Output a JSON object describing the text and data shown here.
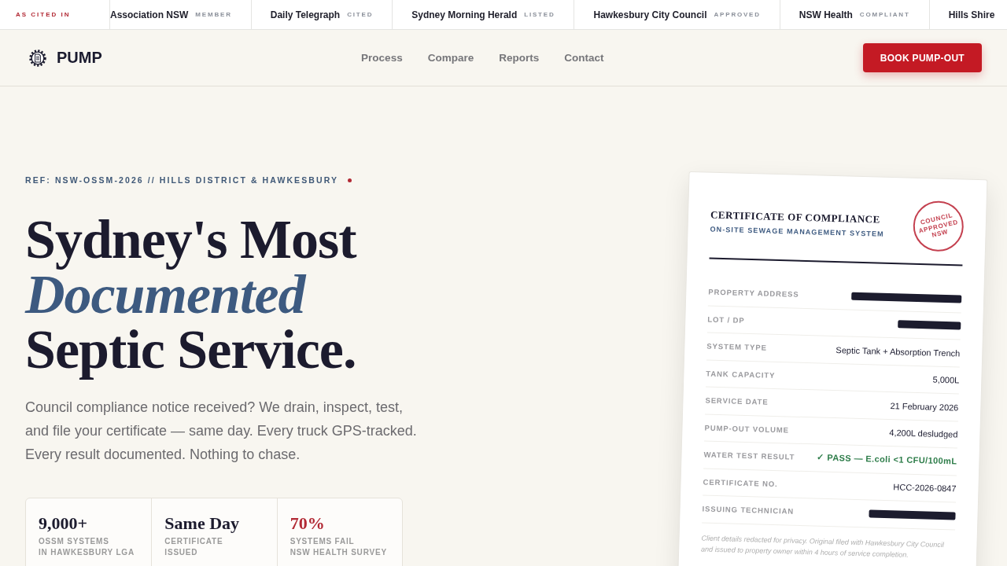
{
  "ticker": {
    "label": "AS CITED IN",
    "items": [
      {
        "name": "Association NSW",
        "tag": "MEMBER"
      },
      {
        "name": "Daily Telegraph",
        "tag": "CITED"
      },
      {
        "name": "Sydney Morning Herald",
        "tag": "LISTED"
      },
      {
        "name": "Hawkesbury City Council",
        "tag": "APPROVED"
      },
      {
        "name": "NSW Health",
        "tag": "COMPLIANT"
      },
      {
        "name": "Hills Shire"
      }
    ]
  },
  "nav": {
    "logo": "PUMP",
    "links": [
      "Process",
      "Compare",
      "Reports",
      "Contact"
    ],
    "cta": "BOOK PUMP-OUT"
  },
  "hero": {
    "ref": "REF: NSW-OSSM-2026 // HILLS DISTRICT & HAWKESBURY",
    "heading": "Sydney's Most *Documented* Septic Service.",
    "lead": "Council compliance notice received? We drain, inspect, test, and file your certificate — same day. Every truck GPS-tracked. Every result documented. Nothing to chase.",
    "stats": [
      {
        "value": "9,000+",
        "label": "OSSM SYSTEMS\nIN HAWKESBURY LGA",
        "highlighted": false
      },
      {
        "value": "Same Day",
        "label": "CERTIFICATE\nISSUED",
        "highlighted": false
      },
      {
        "value": "70%",
        "label": "SYSTEMS FAIL\nNSW HEALTH SURVEY",
        "highlighted": true
      }
    ]
  },
  "certificate": {
    "title": "CERTIFICATE OF COMPLIANCE",
    "subtitle": "ON-SITE SEWAGE MANAGEMENT SYSTEM",
    "stamp": "COUNCIL APPROVED NSW",
    "rows": [
      {
        "label": "PROPERTY ADDRESS",
        "kind": "redacted"
      },
      {
        "label": "LOT / DP",
        "kind": "redacted"
      },
      {
        "label": "SYSTEM TYPE",
        "kind": "text",
        "value": "Septic Tank + Absorption Trench"
      },
      {
        "label": "TANK CAPACITY",
        "kind": "text",
        "value": "5,000L"
      },
      {
        "label": "SERVICE DATE",
        "kind": "text",
        "value": "21 February 2026"
      },
      {
        "label": "PUMP-OUT VOLUME",
        "kind": "text",
        "value": "4,200L desludged"
      },
      {
        "label": "WATER TEST RESULT",
        "kind": "pass",
        "value": "✓ PASS — E.coli <1 CFU/100mL"
      },
      {
        "label": "CERTIFICATE NO.",
        "kind": "text",
        "value": "HCC-2026-0847"
      },
      {
        "label": "ISSUING TECHNICIAN",
        "kind": "redacted"
      }
    ],
    "footnote": "Client details redacted for privacy. Original filed with Hawkesbury City Council and issued to property owner within 4 hours of service completion."
  }
}
